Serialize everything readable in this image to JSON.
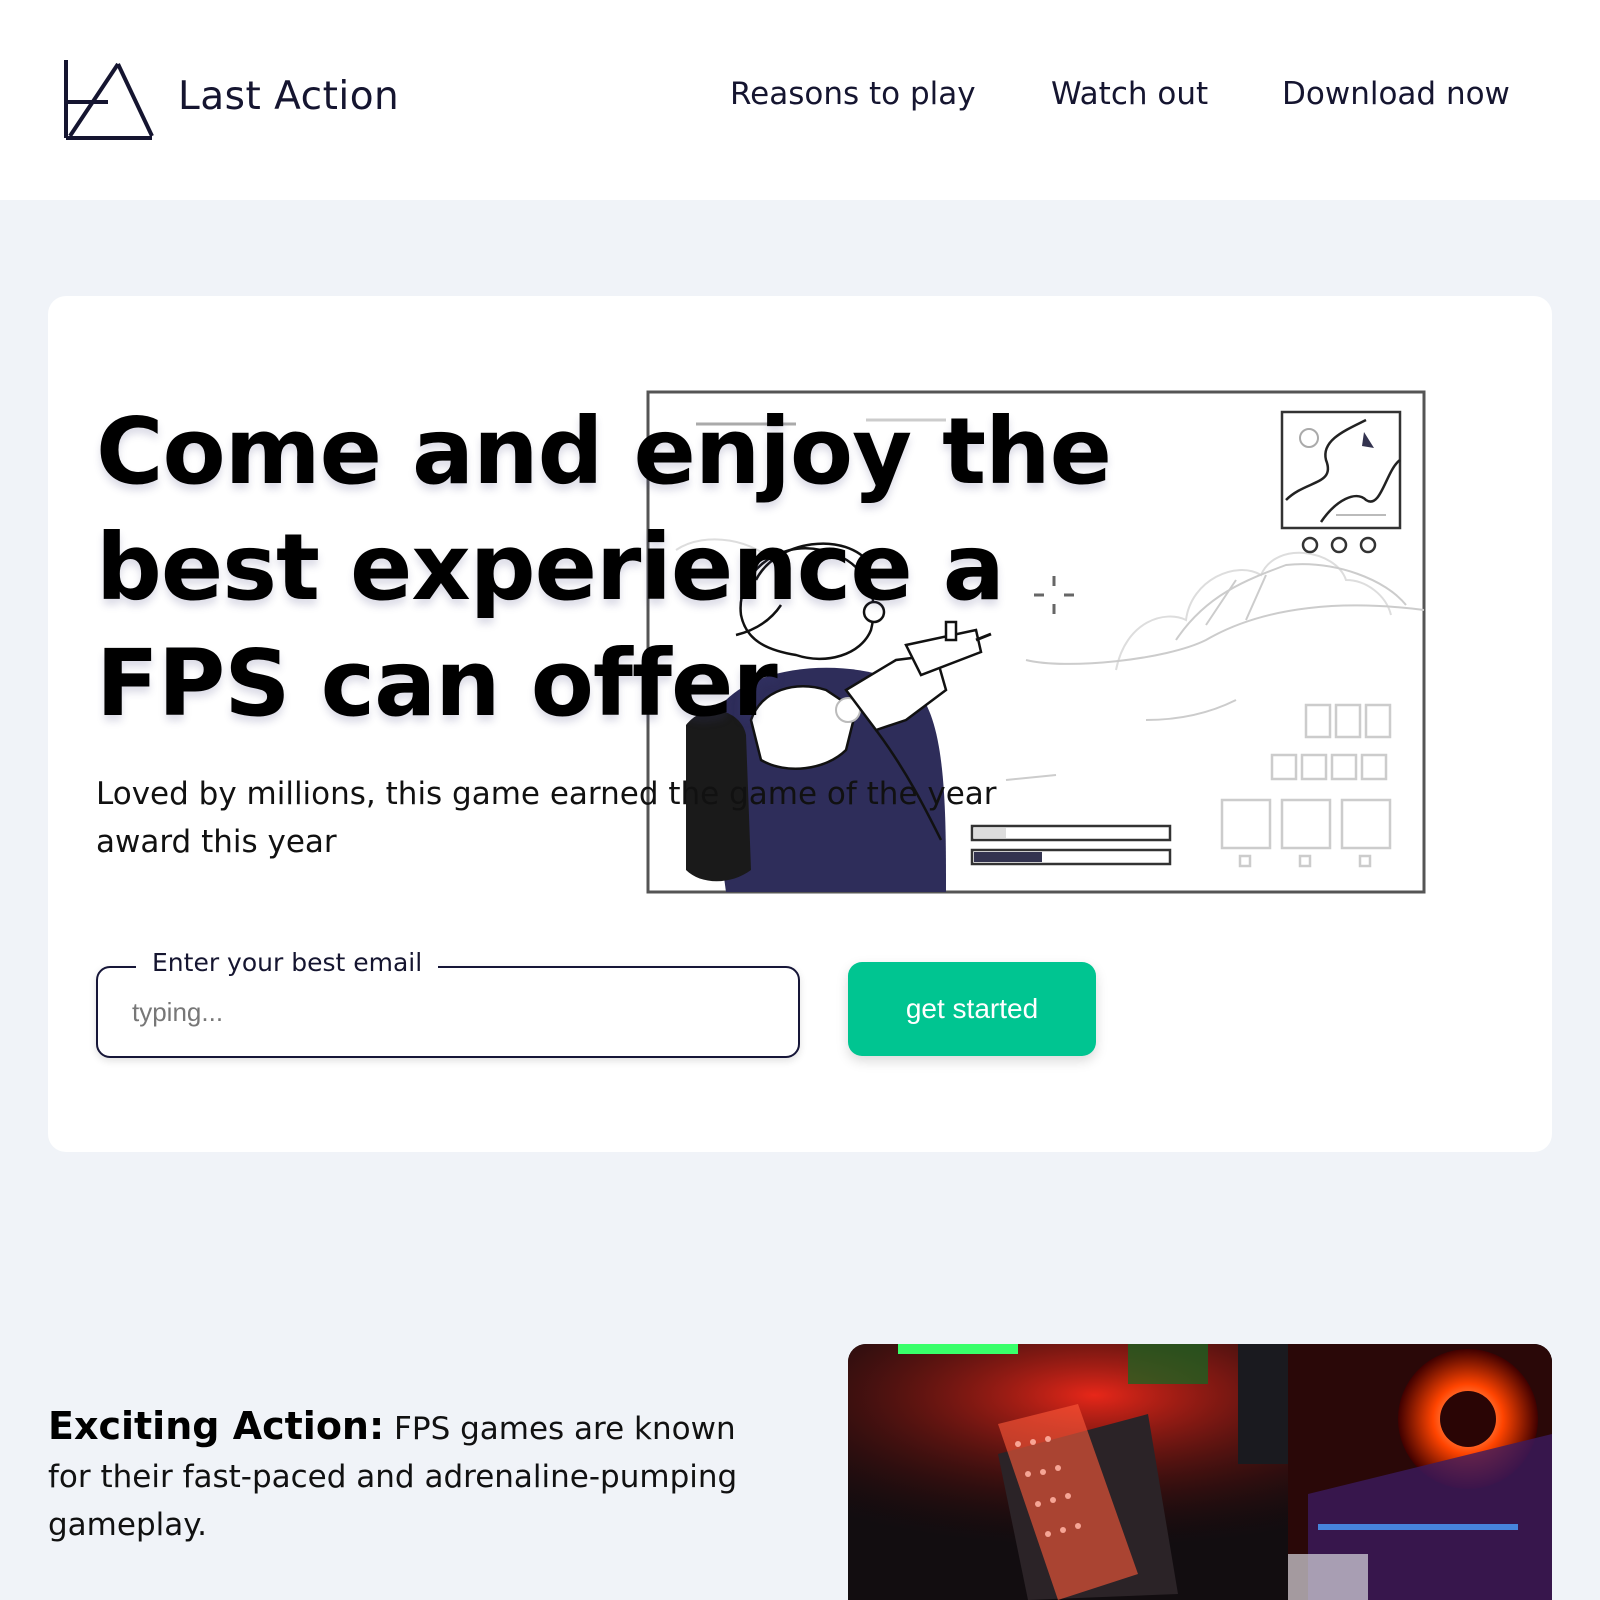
{
  "header": {
    "brand_name": "Last Action",
    "logo_icon": "triangle-logo-icon",
    "nav": [
      {
        "label": "Reasons to play"
      },
      {
        "label": "Watch out"
      },
      {
        "label": "Download now"
      }
    ]
  },
  "hero": {
    "title": "Come and enjoy the best experience a FPS can offer",
    "subtitle": "Loved by millions, this game earned the game of the year award this year",
    "illustration": "fps-player-illustration",
    "email": {
      "legend": "Enter your best email",
      "placeholder": "typing..."
    },
    "cta_label": "get started"
  },
  "feature": {
    "heading": "Exciting Action:",
    "body": "FPS games are known for their fast-paced and adrenaline-pumping gameplay.",
    "image": "gaming-pc-photo"
  },
  "colors": {
    "page_bg": "#f0f3f8",
    "accent": "#00c591",
    "navy": "#161638"
  }
}
